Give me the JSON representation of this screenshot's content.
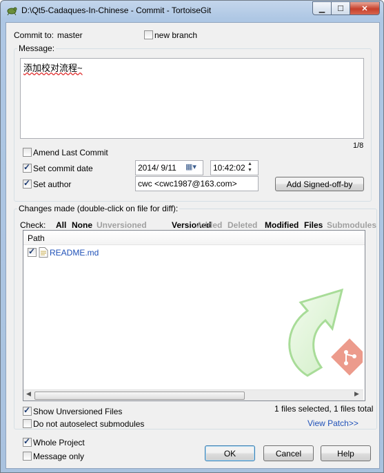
{
  "window": {
    "title": "D:\\Qt5-Cadaques-In-Chinese - Commit - TortoiseGit"
  },
  "commit_to": {
    "label": "Commit to:",
    "branch": "master"
  },
  "new_branch": {
    "label": "new branch",
    "checked": false
  },
  "message": {
    "group_label": "Message:",
    "text": "添加校对流程~",
    "counter": "1/8"
  },
  "amend": {
    "label": "Amend Last Commit",
    "checked": false
  },
  "set_date": {
    "label": "Set commit date",
    "checked": true,
    "date": "2014/ 9/11",
    "time": "10:42:02"
  },
  "set_author": {
    "label": "Set author",
    "checked": true,
    "value": "cwc <cwc1987@163.com>"
  },
  "signoff_button": "Add Signed-off-by",
  "changes": {
    "group_label": "Changes made (double-click on file for diff):",
    "check_label": "Check:",
    "filters": [
      {
        "label": "All",
        "enabled": true
      },
      {
        "label": "None",
        "enabled": true
      },
      {
        "label": "Unversioned",
        "enabled": false
      },
      {
        "label": "Versioned",
        "enabled": true
      },
      {
        "label": "Added",
        "enabled": false
      },
      {
        "label": "Deleted",
        "enabled": false
      },
      {
        "label": "Modified",
        "enabled": true
      },
      {
        "label": "Files",
        "enabled": true
      },
      {
        "label": "Submodules",
        "enabled": false
      }
    ],
    "column_header": "Path",
    "files": [
      {
        "name": "README.md",
        "checked": true
      }
    ],
    "status": "1 files selected, 1 files total"
  },
  "show_unversioned": {
    "label": "Show Unversioned Files",
    "checked": true
  },
  "no_autoselect": {
    "label": "Do not autoselect submodules",
    "checked": false
  },
  "view_patch": "View Patch>>",
  "whole_project": {
    "label": "Whole Project",
    "checked": true
  },
  "message_only": {
    "label": "Message only",
    "checked": false
  },
  "buttons": {
    "ok": "OK",
    "cancel": "Cancel",
    "help": "Help"
  },
  "colors": {
    "title_gradient": "#aec7e4",
    "close_red": "#c7402b",
    "link": "#1f51b8",
    "logo_green": "#7fd36b",
    "git_red": "#e34c26"
  },
  "icons": [
    "tortoisegit-app-icon",
    "minimize-icon",
    "maximize-icon",
    "close-icon",
    "calendar-icon",
    "spin-up-icon",
    "spin-down-icon",
    "text-file-icon",
    "tortoisegit-logo-icon",
    "scroll-left-icon",
    "scroll-right-icon"
  ]
}
